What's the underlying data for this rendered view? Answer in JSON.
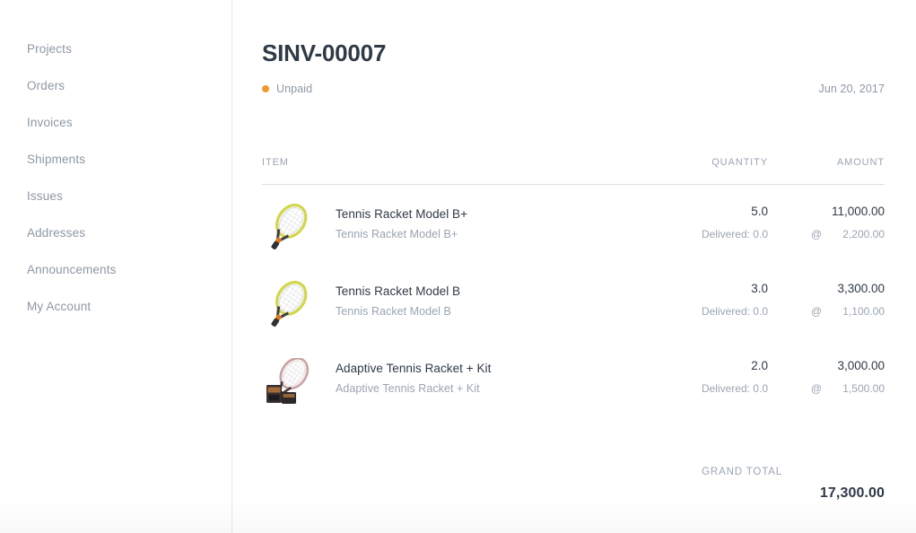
{
  "sidebar": {
    "items": [
      {
        "label": "Projects"
      },
      {
        "label": "Orders"
      },
      {
        "label": "Invoices"
      },
      {
        "label": "Shipments"
      },
      {
        "label": "Issues"
      },
      {
        "label": "Addresses"
      },
      {
        "label": "Announcements"
      },
      {
        "label": "My Account"
      }
    ]
  },
  "document": {
    "title": "SINV-00007",
    "status": {
      "label": "Unpaid",
      "color": "#f0992e"
    },
    "date": "Jun 20, 2017"
  },
  "table": {
    "headers": {
      "item": "ITEM",
      "quantity": "QUANTITY",
      "amount": "AMOUNT"
    },
    "rate_prefix": "@",
    "rows": [
      {
        "name": "Tennis Racket Model B+",
        "description": "Tennis Racket Model B+",
        "quantity": "5.0",
        "delivered": "Delivered: 0.0",
        "amount": "11,000.00",
        "rate": "2,200.00",
        "rate_prefix": "@",
        "image": "tennis-racket"
      },
      {
        "name": "Tennis Racket Model B",
        "description": "Tennis Racket Model B",
        "quantity": "3.0",
        "delivered": "Delivered: 0.0",
        "amount": "3,300.00",
        "rate": "1,100.00",
        "rate_prefix": "@",
        "image": "tennis-racket"
      },
      {
        "name": "Adaptive Tennis Racket + Kit",
        "description": "Adaptive Tennis Racket + Kit",
        "quantity": "2.0",
        "delivered": "Delivered: 0.0",
        "amount": "3,000.00",
        "rate": "1,500.00",
        "rate_prefix": "@",
        "image": "tennis-racket-kit"
      }
    ]
  },
  "totals": {
    "grand_total_label": "GRAND TOTAL",
    "grand_total_value": "17,300.00"
  }
}
